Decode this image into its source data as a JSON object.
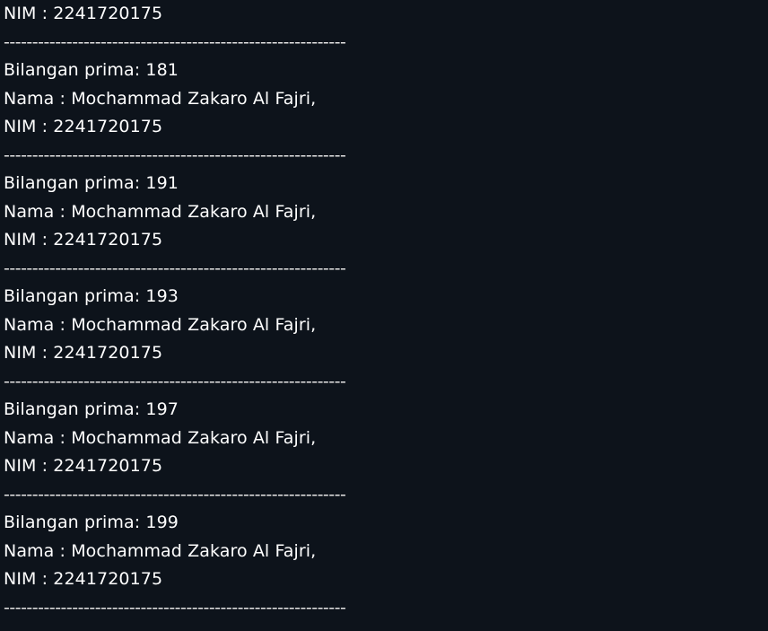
{
  "console": {
    "top_line": "NIM : 2241720175",
    "divider": "------------------------------------------------------------",
    "blocks": [
      {
        "prime": "Bilangan prima: 181",
        "name": "Nama : Mochammad Zakaro Al Fajri,",
        "nim": "NIM : 2241720175"
      },
      {
        "prime": "Bilangan prima: 191",
        "name": "Nama : Mochammad Zakaro Al Fajri,",
        "nim": "NIM : 2241720175"
      },
      {
        "prime": "Bilangan prima: 193",
        "name": "Nama : Mochammad Zakaro Al Fajri,",
        "nim": "NIM : 2241720175"
      },
      {
        "prime": "Bilangan prima: 197",
        "name": "Nama : Mochammad Zakaro Al Fajri,",
        "nim": "NIM : 2241720175"
      },
      {
        "prime": "Bilangan prima: 199",
        "name": "Nama : Mochammad Zakaro Al Fajri,",
        "nim": "NIM : 2241720175"
      }
    ]
  },
  "colors": {
    "background": "#0d131b",
    "text": "#ffffff"
  }
}
